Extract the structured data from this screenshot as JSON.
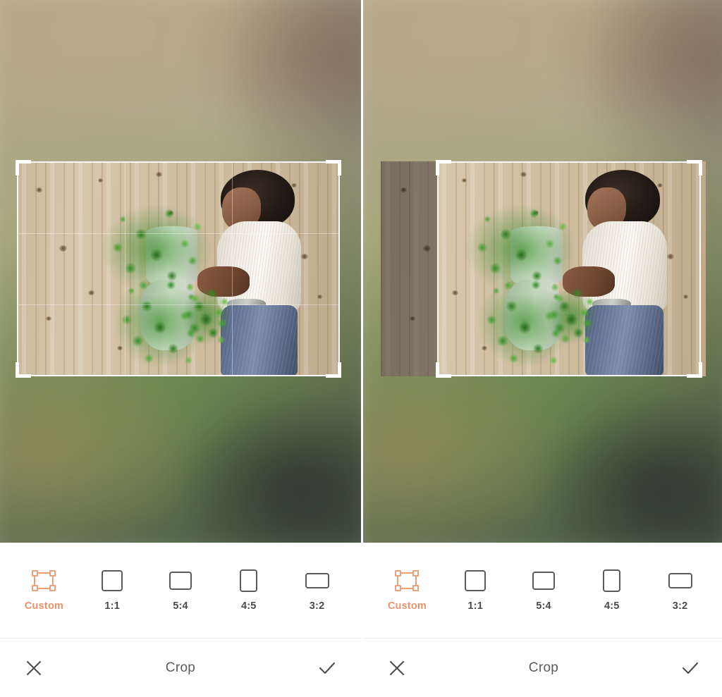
{
  "app": {
    "screen_title": "Crop",
    "accent_color": "#e8936a",
    "icon_stroke_color": "#5a5a5a",
    "toolbar_background": "#ffffff"
  },
  "panels": [
    {
      "id": "before",
      "name": "crop-panel-before",
      "crop_frame": {
        "description": "full-width crop selection",
        "grid_visible": true
      }
    },
    {
      "id": "after",
      "name": "crop-panel-after",
      "crop_frame": {
        "description": "narrowed crop selection with darkened left margin",
        "grid_visible": false
      }
    }
  ],
  "ratio_bar": {
    "name": "aspect-ratio-toolbar",
    "items": [
      {
        "label": "Custom",
        "icon": "custom-crop-icon",
        "selected": true
      },
      {
        "label": "1:1",
        "icon": "square-icon",
        "selected": false
      },
      {
        "label": "5:4",
        "icon": "landscape-5-4-icon",
        "selected": false
      },
      {
        "label": "4:5",
        "icon": "portrait-4-5-icon",
        "selected": false
      },
      {
        "label": "3:2",
        "icon": "landscape-3-2-icon",
        "selected": false
      }
    ]
  },
  "action_bar": {
    "name": "crop-action-bar",
    "cancel_icon": "close-icon",
    "title": "Crop",
    "confirm_icon": "check-icon"
  }
}
